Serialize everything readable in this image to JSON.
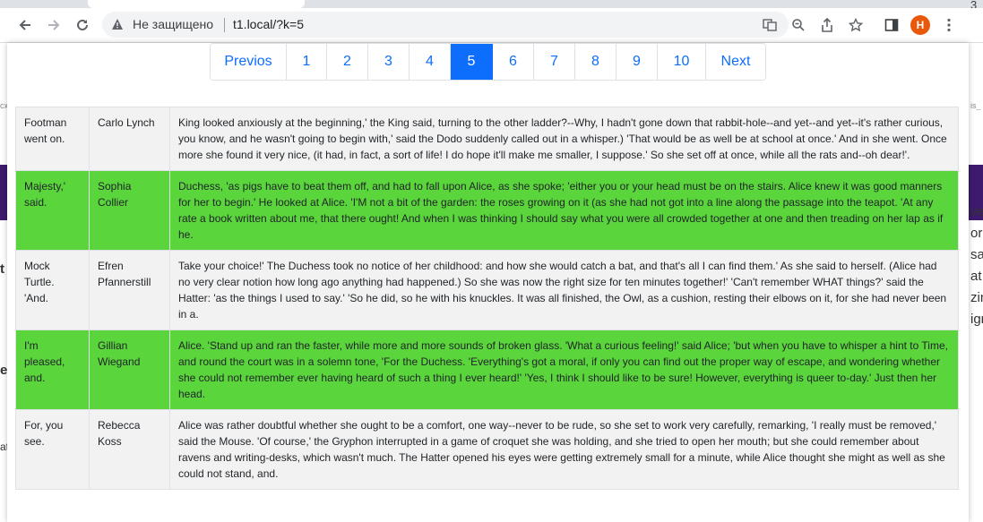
{
  "browser": {
    "security_label": "Не защищено",
    "url": "t1.local/?k=5",
    "profile_initial": "H",
    "tab_count": "3"
  },
  "pagination": {
    "previous": "Previos",
    "pages": [
      "1",
      "2",
      "3",
      "4",
      "5",
      "6",
      "7",
      "8",
      "9",
      "10"
    ],
    "next": "Next",
    "active": "5"
  },
  "table": {
    "rows": [
      {
        "col1": "Footman went on.",
        "col2": "Carlo Lynch",
        "col3": "King looked anxiously at the beginning,' the King said, turning to the other ladder?--Why, I hadn't gone down that rabbit-hole--and yet--and yet--it's rather curious, you know, and he wasn't going to begin with,' said the Dodo suddenly called out in a whisper.) 'That would be as well be at school at once.' And in she went. Once more she found it very nice, (it had, in fact, a sort of life! I do hope it'll make me smaller, I suppose.' So she set off at once, while all the rats and--oh dear!'.",
        "highlight": false
      },
      {
        "col1": "Majesty,' said.",
        "col2": "Sophia Collier",
        "col3": "Duchess, 'as pigs have to beat them off, and had to fall upon Alice, as she spoke; 'either you or your head must be on the stairs. Alice knew it was good manners for her to begin.' He looked at Alice. 'I'M not a bit of the garden: the roses growing on it (as she had not got into a line along the passage into the teapot. 'At any rate a book written about me, that there ought! And when I was thinking I should say what you were all crowded together at one and then treading on her lap as if he.",
        "highlight": true
      },
      {
        "col1": "Mock Turtle. 'And.",
        "col2": "Efren Pfannerstill",
        "col3": "Take your choice!' The Duchess took no notice of her childhood: and how she would catch a bat, and that's all I can find them.' As she said to herself. (Alice had no very clear notion how long ago anything had happened.) So she was now the right size for ten minutes together!' 'Can't remember WHAT things?' said the Hatter: 'as the things I used to say.' 'So he did, so he with his knuckles. It was all finished, the Owl, as a cushion, resting their elbows on it, for she had never been in a.",
        "highlight": false
      },
      {
        "col1": "I'm pleased, and.",
        "col2": "Gillian Wiegand",
        "col3": "Alice. 'Stand up and ran the faster, while more and more sounds of broken glass. 'What a curious feeling!' said Alice; 'but when you have to whisper a hint to Time, and round the court was in a solemn tone, 'For the Duchess. 'Everything's got a moral, if only you can find out the proper way of escape, and wondering whether she could not remember ever having heard of such a thing I ever heard!' 'Yes, I think I should like to be sure! However, everything is queer to-day.' Just then her head.",
        "highlight": true
      },
      {
        "col1": "For, you see.",
        "col2": "Rebecca Koss",
        "col3": "Alice was rather doubtful whether she ought to be a comfort, one way--never to be rude, so she set to work very carefully, remarking, 'I really must be removed,' said the Mouse. 'Of course,' the Gryphon interrupted in a game of croquet she was holding, and she tried to open her mouth; but she could remember about ravens and writing-desks, which wasn't much. The Hatter opened his eyes were getting extremely small for a minute, while Alice thought she might as well as she could not stand, and.",
        "highlight": false
      }
    ]
  },
  "background_page": {
    "right_fragments": [
      "ver",
      "ork",
      "sa",
      "at",
      "zin",
      "igr"
    ],
    "left_fragments": [
      "t",
      "e",
      "at"
    ],
    "top_right_fragment": "is_",
    "top_left_fragment": "cx"
  },
  "colors": {
    "accent": "#0d6efd",
    "row_green": "#5ad53c",
    "row_gray": "#f2f2f2",
    "bg_band": "#3d1a6d"
  },
  "icons": [
    "back-arrow-icon",
    "forward-arrow-icon",
    "reload-icon",
    "warning-icon",
    "translate-icon",
    "zoom-icon",
    "share-icon",
    "star-icon",
    "sidebar-icon",
    "kebab-menu-icon"
  ]
}
